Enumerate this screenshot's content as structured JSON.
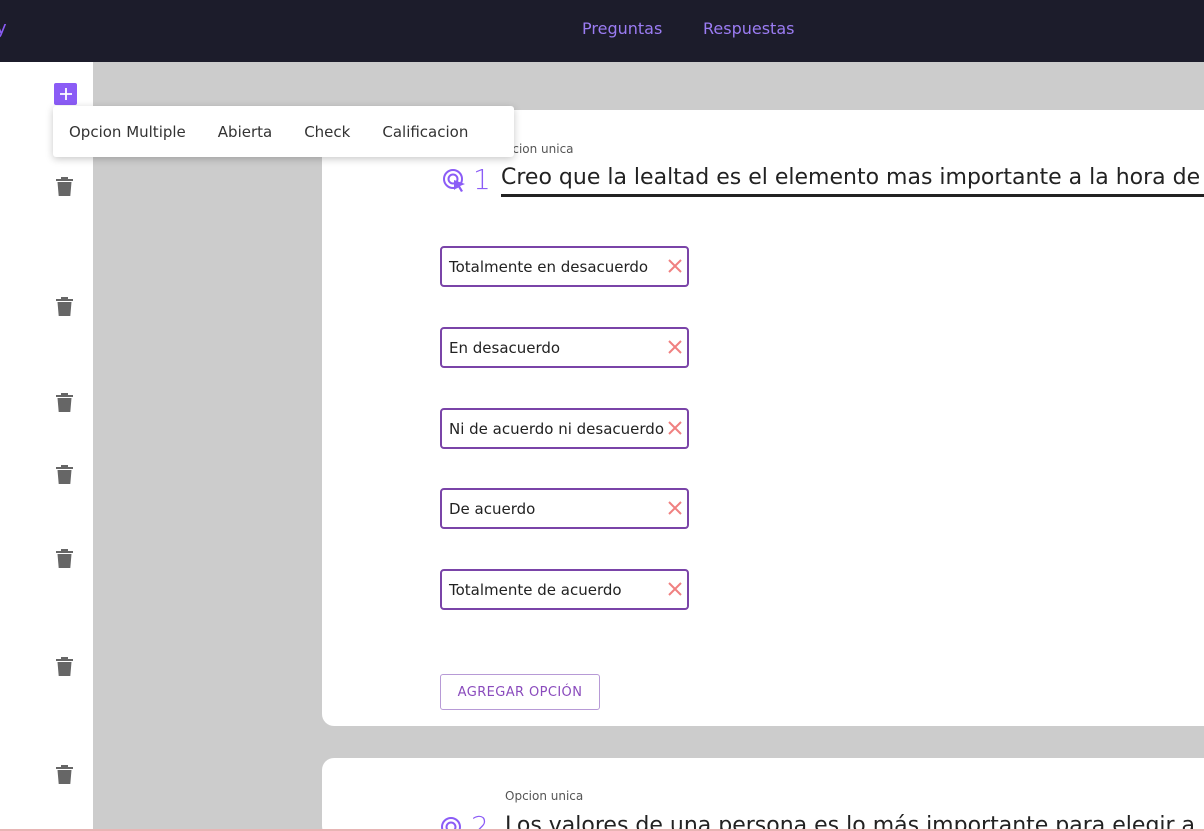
{
  "header": {
    "brand_fragment": "y",
    "nav": [
      "Preguntas",
      "Respuestas"
    ]
  },
  "sidebar": {
    "add_symbol": "+",
    "icons": [
      "plus-icon",
      "trash-icon"
    ]
  },
  "type_menu": {
    "items": [
      "Opcion Multiple",
      "Abierta",
      "Check",
      "Calificacion"
    ]
  },
  "questions": [
    {
      "type_label": "Opcion unica",
      "type_label_visible": "ocion unica",
      "number": "1",
      "text": "Creo que la lealtad es el elemento mas importante a la hora de",
      "options": [
        "Totalmente en desacuerdo",
        "En desacuerdo",
        "Ni de acuerdo ni desacuerdo",
        "De acuerdo",
        "Totalmente de acuerdo"
      ],
      "add_option_label": "AGREGAR OPCIÓN"
    },
    {
      "type_label": "Opcion unica",
      "number": "2",
      "text": "Los valores de una persona es lo más importante para elegir a"
    }
  ],
  "colors": {
    "topbar": "#1c1c2b",
    "accent": "#8b5cf6",
    "option_border": "#7a44a8",
    "remove_x": "#f08080",
    "canvas": "#cccccc"
  }
}
